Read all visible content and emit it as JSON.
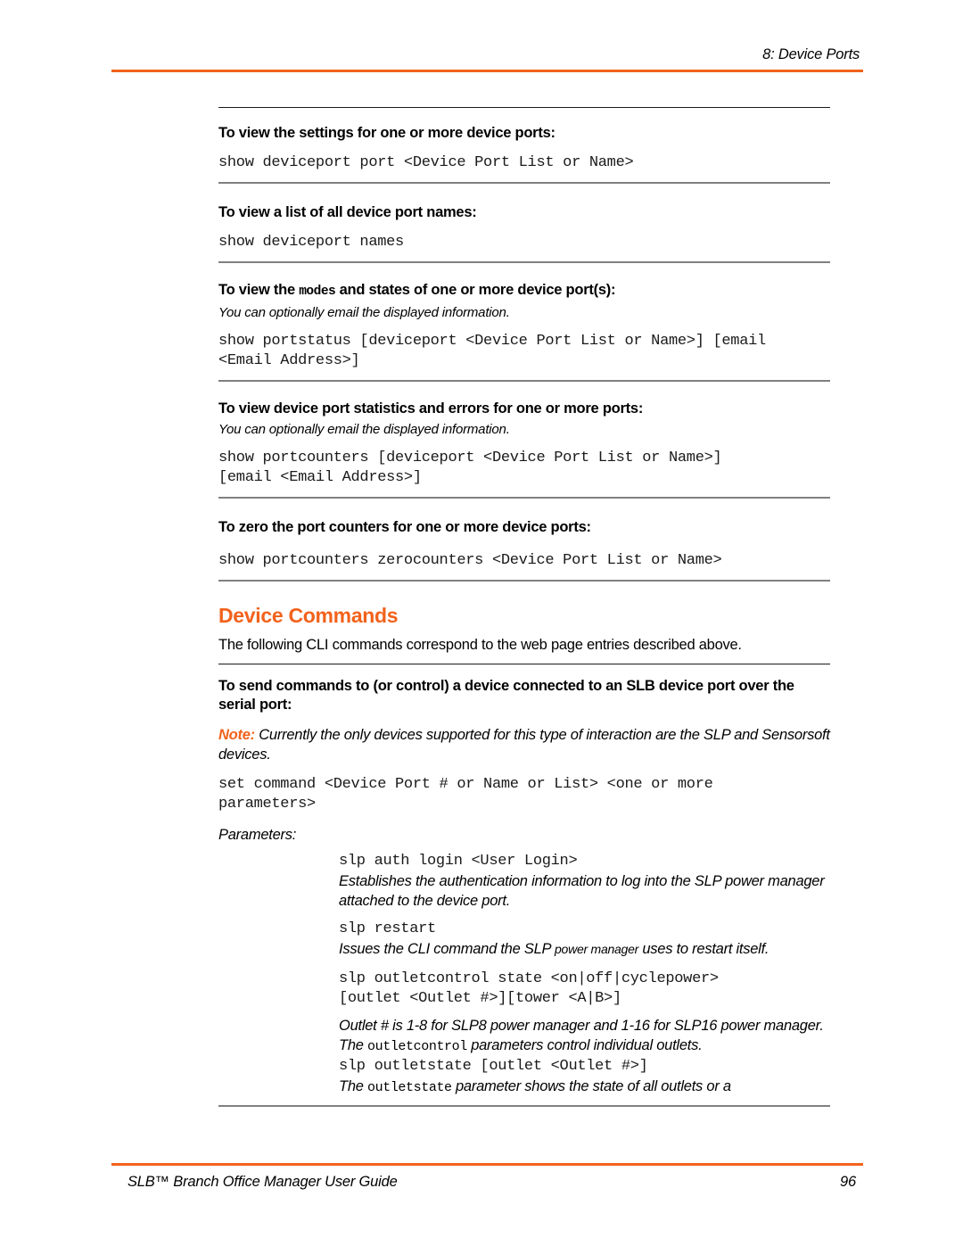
{
  "header": {
    "chapter": "8: Device Ports"
  },
  "colors": {
    "accent_orange": "#F2621B",
    "rule_gray": "#808080",
    "rule_black": "#1a1a1a",
    "text": "#000000"
  },
  "blocks": [
    {
      "heading": "To view the settings for one or more device ports:",
      "command": "show deviceport port <Device Port List or Name>"
    },
    {
      "heading": "To view a list of all device port names:",
      "command": "show deviceport names"
    },
    {
      "heading_pre": "To view the ",
      "heading_mono": "modes",
      "heading_post": " and states of one or more device port(s):",
      "note": "You can optionally email the displayed information.",
      "command": "show portstatus [deviceport <Device Port List or Name>] [email\n<Email Address>]"
    },
    {
      "heading": "To view device port statistics and errors for one or more ports:",
      "note": "You can optionally email the displayed information.",
      "command": "show portcounters [deviceport <Device Port List or Name>]\n[email <Email Address>]"
    },
    {
      "heading": "To zero the port counters for one or more device ports:",
      "command": "show portcounters zerocounters <Device Port List or Name>"
    }
  ],
  "section": {
    "title": "Device Commands",
    "intro": "The following CLI commands correspond to the web page entries described above.",
    "heading": "To send commands to (or control) a device connected to an SLB device port over the serial port:",
    "note_label": "Note:",
    "note_text": " Currently the only devices supported for this type of interaction are the SLP and Sensorsoft devices.",
    "command": "set command <Device Port # or Name or List> <one or more\nparameters>",
    "parameters_label": "Parameters:",
    "parameters": [
      {
        "command": "slp auth login <User Login>",
        "desc_pre": "Establishes the authentication information to log into the SLP power manager attached to the device port.",
        "desc_mono": "",
        "desc_post": ""
      },
      {
        "command": "slp restart",
        "desc_pre": "Issues the CLI command the SLP ",
        "desc_small": "power manager",
        "desc_post": " uses to restart itself."
      },
      {
        "command": "slp outletcontrol state <on|off|cyclepower>\n[outlet <Outlet #>][tower <A|B>]",
        "desc_pre": "Outlet # is 1-8 for SLP8 power manager and 1-16 for SLP16 power manager.",
        "desc2_pre": "The ",
        "desc2_mono": "outletcontrol",
        "desc2_post": " parameters control individual outlets."
      },
      {
        "command": "slp outletstate [outlet <Outlet #>]",
        "desc2_pre": "The ",
        "desc2_mono": "outletstate",
        "desc2_post": " parameter shows the state of all outlets or a"
      }
    ]
  },
  "footer": {
    "title": "SLB™ Branch Office Manager User Guide",
    "page_number": "96"
  }
}
